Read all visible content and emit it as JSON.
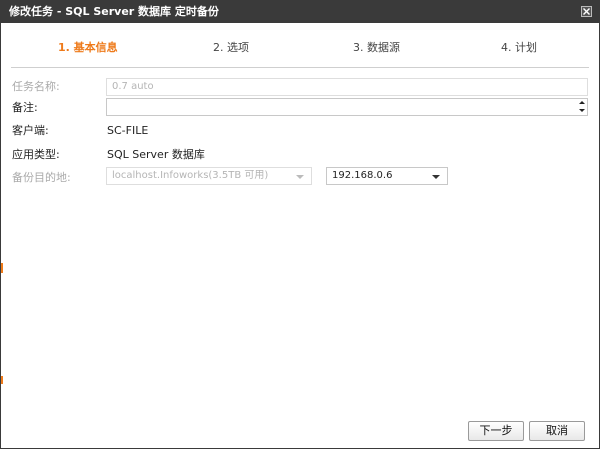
{
  "window": {
    "title": "修改任务 - SQL Server 数据库 定时备份"
  },
  "steps": [
    {
      "label": "1. 基本信息",
      "active": true
    },
    {
      "label": "2. 选项",
      "active": false
    },
    {
      "label": "3. 数据源",
      "active": false
    },
    {
      "label": "4. 计划",
      "active": false
    }
  ],
  "form": {
    "task_name": {
      "label": "任务名称:",
      "value": "0.7 auto"
    },
    "note": {
      "label": "备注:",
      "value": ""
    },
    "client": {
      "label": "客户端:",
      "value": "SC-FILE"
    },
    "app_type": {
      "label": "应用类型:",
      "value": "SQL Server 数据库"
    },
    "backup_target": {
      "label": "备份目的地:",
      "storage_selected": "localhost.Infoworks(3.5TB 可用)",
      "ip_selected": "192.168.0.6"
    }
  },
  "buttons": {
    "next": "下一步",
    "cancel": "取消"
  },
  "colors": {
    "titlebar": "#3a3a3a",
    "accent": "#ee7a1a"
  }
}
